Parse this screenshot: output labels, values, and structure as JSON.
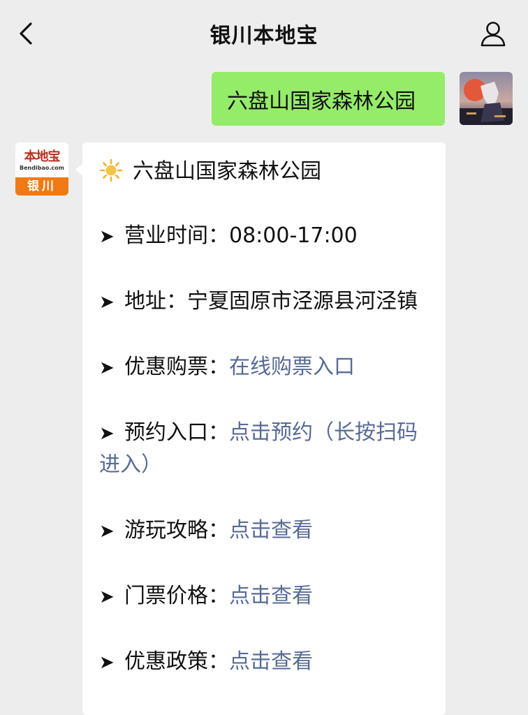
{
  "header": {
    "title": "银川本地宝",
    "back_icon": "chevron-left-icon",
    "profile_icon": "person-icon"
  },
  "outgoing": {
    "text": "六盘山国家森林公园"
  },
  "brand": {
    "name": "本地宝",
    "site": "Bendibao.com",
    "city": "银川"
  },
  "card": {
    "title_icon": "sun-icon",
    "title": "六盘山国家森林公园",
    "arrow": "➤",
    "items": [
      {
        "label": "营业时间：",
        "value": "08:00-17:00",
        "link": false
      },
      {
        "label": "地址：",
        "value": "宁夏固原市泾源县河泾镇",
        "link": false
      },
      {
        "label": "优惠购票：",
        "value": "在线购票入口",
        "link": true
      },
      {
        "label": "预约入口：",
        "value": "点击预约（长按扫码",
        "value_line2": "进入）",
        "link": true
      },
      {
        "label": "游玩攻略：",
        "value": "点击查看",
        "link": true
      },
      {
        "label": "门票价格：",
        "value": "点击查看",
        "link": true
      },
      {
        "label": "优惠政策：",
        "value": "点击查看",
        "link": true
      }
    ]
  },
  "colors": {
    "background": "#ededed",
    "outgoing_bubble": "#95ec69",
    "link": "#576b95",
    "brand_orange": "#f07a14",
    "brand_red": "#b8301f"
  }
}
